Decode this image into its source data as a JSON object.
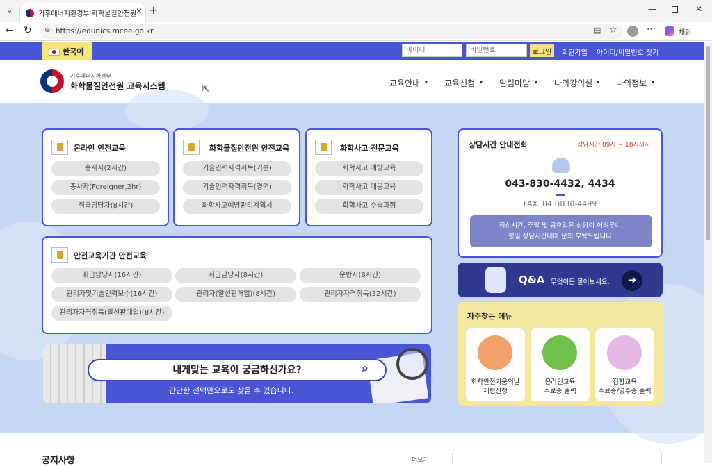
{
  "browser": {
    "tab_title": "기후에너지환경부 화학물질안전원",
    "url": "https://edunics.mcee.go.kr",
    "copilot_label": "채팅"
  },
  "topbar": {
    "language": "한국어",
    "id_placeholder": "아이디",
    "pw_placeholder": "비밀번호",
    "login": "로그인",
    "signup": "회원가입",
    "find": "아이디/비밀번호 찾기"
  },
  "header": {
    "ministry": "기후에너지환경부",
    "site_name": "화학물질안전원 교육시스템",
    "nav": [
      "교육안내",
      "교육신청",
      "알림마당",
      "나의강의실",
      "나의정보"
    ]
  },
  "cards": {
    "online": {
      "title": "온라인 안전교육",
      "items": [
        "종사자(2시간)",
        "종사자(Foreigner,2hr)",
        "취급담당자(8시간)"
      ]
    },
    "institute": {
      "title": "화학물질안전원 안전교육",
      "items": [
        "기술인력자격취득(기본)",
        "기술인력자격취득(경력)",
        "화학사고예방관리계획서"
      ]
    },
    "accident": {
      "title": "화학사고 전문교육",
      "items": [
        "화학사고 예방교육",
        "화학사고 대응교육",
        "화학사고 수습과정"
      ]
    },
    "agency": {
      "title": "안전교육기관 안전교육",
      "items": [
        "취급담당자(16시간)",
        "취급담당자(8시간)",
        "운반자(8시간)",
        "관리자및기술인력보수(16시간)",
        "관리자(알선판매업)(8시간)",
        "관리자자격취득(32시간)",
        "관리자자격취득(알선판매업)(8시간)"
      ]
    }
  },
  "search": {
    "question": "내게맞는 교육이 궁금하신가요?",
    "subtitle": "간단한 선택만으로도 찾을 수 있습니다."
  },
  "contact": {
    "title": "상담시간 안내전화",
    "hours": "상담시간 09시 ~ 18시까지",
    "phone": "043-830-4432, 4434",
    "fax": "FAX. 043)830-4499",
    "notice_line1": "점심시간, 주말 및 공휴일은 상담이 어려우니,",
    "notice_line2": "평일 상담시간내에 문의 부탁드립니다."
  },
  "qa": {
    "title": "Q&A",
    "text": "무엇이든 물어보세요."
  },
  "freq": {
    "title": "자주찾는 메뉴",
    "items": [
      {
        "line1": "화학안전키움의날",
        "line2": "체험신청"
      },
      {
        "line1": "온라인교육",
        "line2": "수료증 출력"
      },
      {
        "line1": "집합교육",
        "line2": "수료증/영수증 출력"
      }
    ]
  },
  "notice": {
    "title": "공지사항",
    "more": "더보기"
  },
  "colors": {
    "primary": "#4a55d6",
    "accent_yellow": "#f5e27a",
    "hero_bg": "#c6d7f4",
    "red": "#d9332b"
  }
}
